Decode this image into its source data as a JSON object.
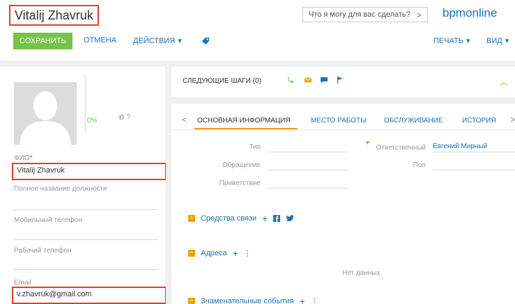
{
  "header": {
    "record_title": "Vitalij Zhavruk",
    "search_placeholder": "Что я могу для вас сделать?",
    "search_arrow": ">",
    "brand": "bpmonline"
  },
  "toolbar": {
    "save_label": "СОХРАНИТЬ",
    "cancel_label": "ОТМЕНА",
    "actions_label": "ДЕЙСТВИЯ",
    "actions_caret": "▾",
    "print_label": "ПЕЧАТЬ",
    "print_caret": "▾",
    "view_label": "ВИД",
    "view_caret": "▾"
  },
  "profile": {
    "completeness": "0%",
    "globe_q": "?",
    "fields": {
      "fio_label": "ФИО",
      "fio_req": "*",
      "fio_value": "Vitalij Zhavruk",
      "job_title_label": "Полное название должности",
      "mobile_label": "Мобильный телефон",
      "work_phone_label": "Рабочий телефон",
      "email_label": "Email",
      "email_value": "v.zhavruk@gmail.com"
    }
  },
  "next_steps": {
    "title": "СЛЕДУЮЩИЕ ШАГИ (0)",
    "caret": "︿"
  },
  "tabs": {
    "prev": "<",
    "next": ">",
    "items": [
      {
        "label": "ОСНОВНАЯ ИНФОРМАЦИЯ",
        "active": true
      },
      {
        "label": "МЕСТО РАБОТЫ",
        "active": false
      },
      {
        "label": "ОБСЛУЖИВАНИЕ",
        "active": false
      },
      {
        "label": "ИСТОРИЯ",
        "active": false
      }
    ]
  },
  "main_fields": {
    "type_label": "Тип",
    "address_label": "Обращение",
    "greeting_label": "Приветствие",
    "owner_label": "Ответственный",
    "owner_value": "Евгений Мирный",
    "gender_label": "Пол"
  },
  "groups": {
    "communications": {
      "toggle": "^",
      "title": "Средства связи",
      "add": "+"
    },
    "addresses": {
      "toggle": "^",
      "title": "Адреса",
      "add": "+",
      "menu": "⋮",
      "empty": "Нет данных"
    },
    "events": {
      "toggle": "^",
      "title": "Знаменательные события",
      "add": "+",
      "menu": "⋮"
    }
  },
  "colors": {
    "accent_green": "#75c34a",
    "accent_orange": "#f39c12",
    "link_blue": "#1d71b8",
    "highlight_red": "#e03c31"
  }
}
